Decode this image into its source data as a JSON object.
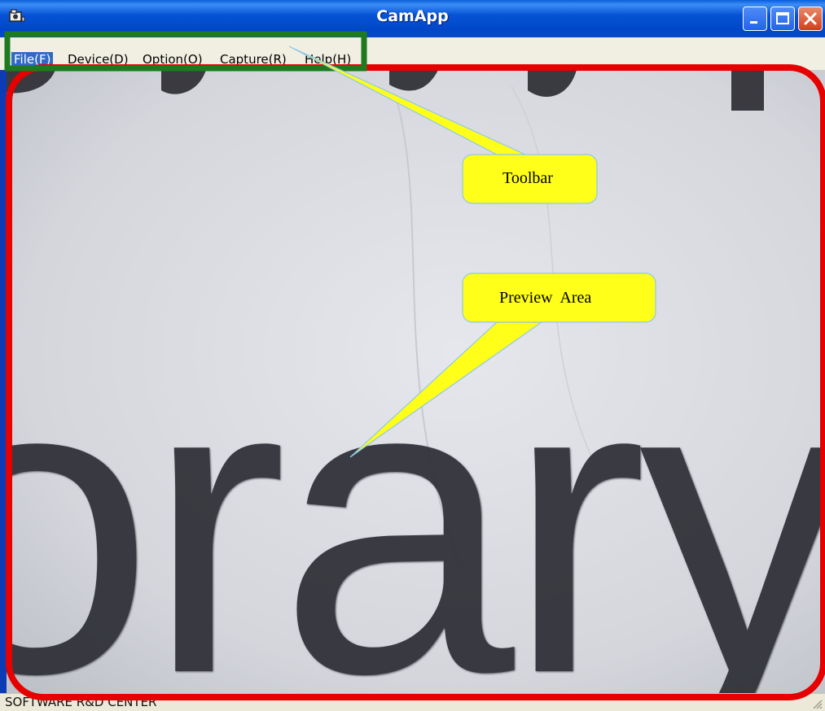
{
  "window": {
    "title": "CamApp"
  },
  "menu": {
    "items": [
      "File(F)",
      "Device(D)",
      "Option(O)",
      "Capture(R)",
      "Help(H)"
    ]
  },
  "status": {
    "text": "SOFTWARE R&D CENTER"
  },
  "annotations": {
    "toolbar_label": "Toolbar",
    "preview_label": "Preview  Area"
  },
  "preview": {
    "visible_text": "orary"
  },
  "colors": {
    "toolbar_outline": "#1E7A1E",
    "preview_outline": "#E60000",
    "callout_fill": "#FFFF1A",
    "titlebar": "#0A4FD0"
  }
}
